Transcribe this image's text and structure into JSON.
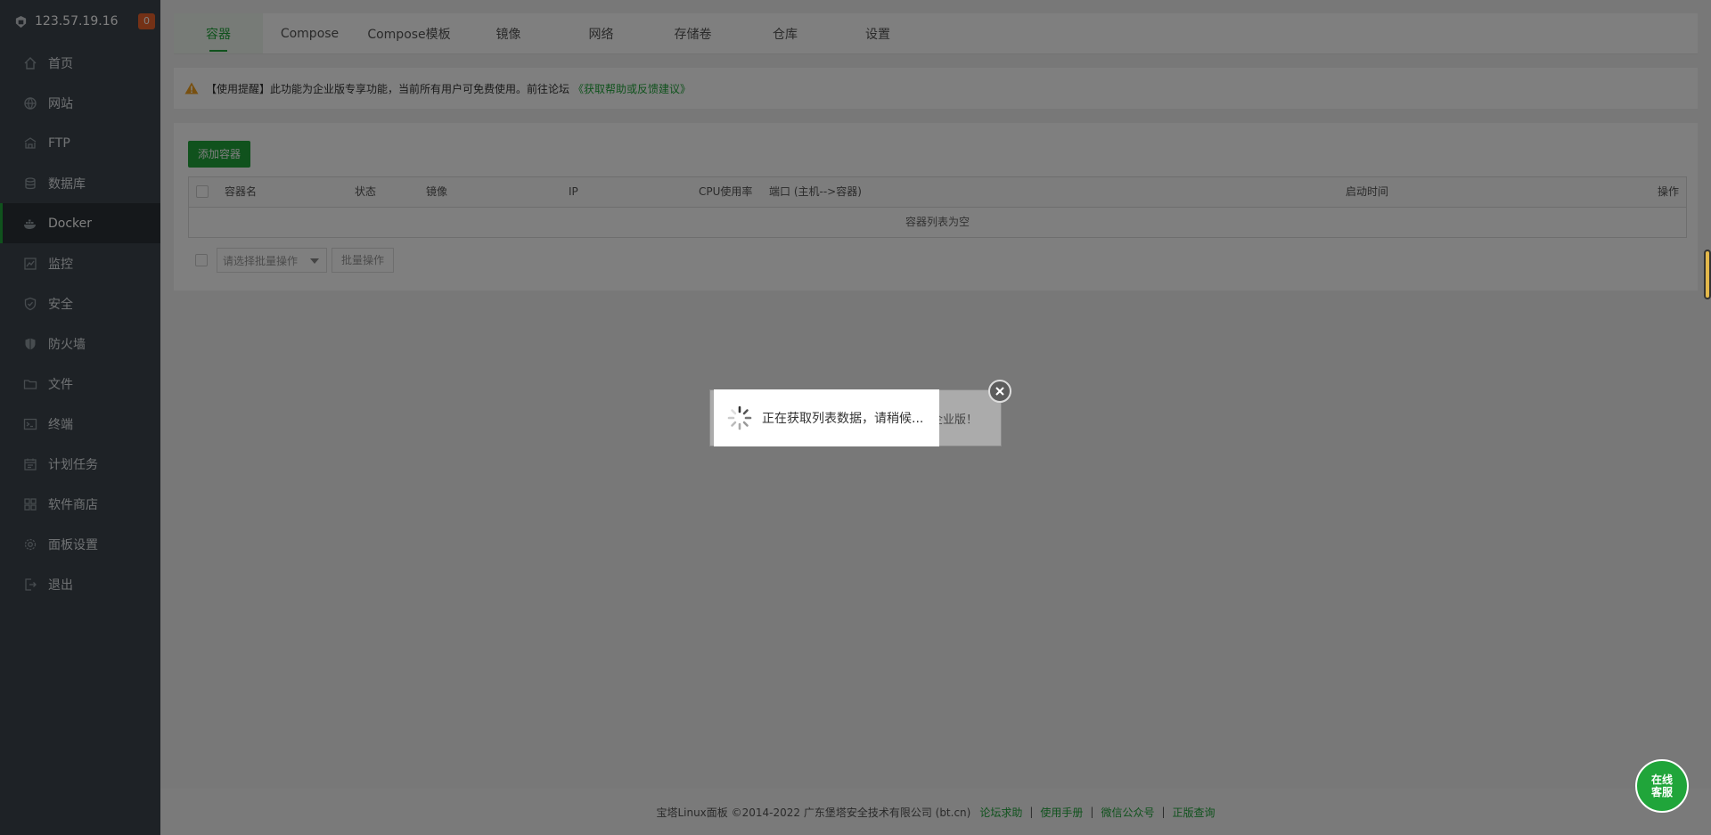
{
  "sidebar": {
    "ip": "123.57.19.16",
    "badge": "0",
    "items": [
      {
        "label": "首页",
        "icon": "home-icon"
      },
      {
        "label": "网站",
        "icon": "globe-icon"
      },
      {
        "label": "FTP",
        "icon": "ftp-icon"
      },
      {
        "label": "数据库",
        "icon": "database-icon"
      },
      {
        "label": "Docker",
        "icon": "docker-icon",
        "active": true
      },
      {
        "label": "监控",
        "icon": "monitor-icon"
      },
      {
        "label": "安全",
        "icon": "shield-icon"
      },
      {
        "label": "防火墙",
        "icon": "firewall-icon"
      },
      {
        "label": "文件",
        "icon": "folder-icon"
      },
      {
        "label": "终端",
        "icon": "terminal-icon"
      },
      {
        "label": "计划任务",
        "icon": "calendar-icon"
      },
      {
        "label": "软件商店",
        "icon": "apps-icon"
      },
      {
        "label": "面板设置",
        "icon": "gear-icon"
      },
      {
        "label": "退出",
        "icon": "logout-icon"
      }
    ]
  },
  "tabs": [
    {
      "label": "容器",
      "active": true
    },
    {
      "label": "Compose"
    },
    {
      "label": "Compose模板"
    },
    {
      "label": "镜像"
    },
    {
      "label": "网络"
    },
    {
      "label": "存储卷"
    },
    {
      "label": "仓库"
    },
    {
      "label": "设置"
    }
  ],
  "notice": {
    "text": "【使用提醒】此功能为企业版专享功能，当前所有用户可免费使用。前往论坛",
    "link": "《获取帮助或反馈建议》"
  },
  "containers": {
    "add_button": "添加容器",
    "columns": {
      "name": "容器名",
      "status": "状态",
      "image": "镜像",
      "ip": "IP",
      "cpu": "CPU使用率",
      "port": "端口 (主机-->容器)",
      "start_time": "启动时间",
      "actions": "操作"
    },
    "empty_text": "容器列表为空",
    "batch_placeholder": "请选择批量操作",
    "batch_button": "批量操作"
  },
  "footer": {
    "copyright": "宝塔Linux面板 ©2014-2022 广东堡塔安全技术有限公司 (bt.cn)",
    "links": [
      "论坛求助",
      "使用手册",
      "微信公众号",
      "正版查询"
    ]
  },
  "dialog": {
    "behind_text": "企业版！",
    "loading_text": "正在获取列表数据，请稍候..."
  },
  "chat_button": {
    "line1": "在线",
    "line2": "客服"
  },
  "colors": {
    "accent": "#20a53a",
    "sidebar": "#3c444d",
    "badge": "#e8632d"
  }
}
